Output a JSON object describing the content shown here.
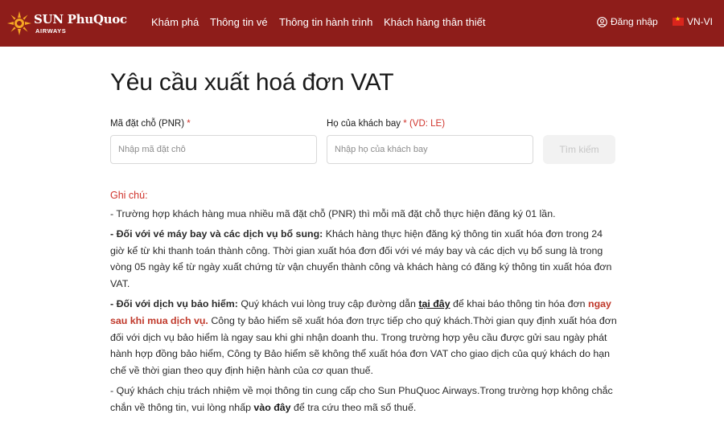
{
  "header": {
    "logo_main": "SUN PhuQuoc",
    "logo_sub": "AIRWAYS",
    "nav": [
      "Khám phá",
      "Thông tin vé",
      "Thông tin hành trình",
      "Khách hàng thân thiết"
    ],
    "login_label": "Đăng nhập",
    "lang_label": "VN-VI",
    "bg_color": "#8e1d1a"
  },
  "page": {
    "title": "Yêu cầu xuất hoá đơn VAT"
  },
  "form": {
    "pnr_label": "Mã đặt chỗ (PNR)",
    "pnr_required": "*",
    "pnr_placeholder": "Nhập mã đặt chỗ",
    "surname_label": "Họ của khách bay",
    "surname_required": "*",
    "surname_hint": "(VD: LE)",
    "surname_placeholder": "Nhập họ của khách bay",
    "search_label": "Tìm kiếm"
  },
  "notes": {
    "title": "Ghi chú:",
    "n1": "- Trường hợp khách hàng mua nhiều mã đặt chỗ (PNR) thì mỗi mã đặt chỗ thực hiện đăng ký 01 lần.",
    "n2_bold": "- Đối với vé máy bay và các dịch vụ bổ sung:",
    "n2_text": " Khách hàng thực hiện đăng ký thông tin xuất hóa đơn trong 24 giờ kể từ khi thanh toán thành công. Thời gian xuất hóa đơn đối với vé máy bay và các dịch vụ bổ sung là trong vòng 05 ngày kể từ ngày xuất chứng từ vận chuyển thành công và khách hàng có đăng ký thông tin xuất hóa đơn VAT.",
    "n3_bold": "- Đối với dịch vụ bảo hiểm:",
    "n3_text1": " Quý khách vui lòng truy cập đường dẫn ",
    "n3_link": "tại đây",
    "n3_text2": " để khai báo thông tin hóa đơn ",
    "n3_red": "ngay sau khi mua dịch vụ.",
    "n3_text3": " Công ty bảo hiểm sẽ xuất hóa đơn trực tiếp cho quý khách.Thời gian quy định xuất hóa đơn đối với dịch vụ bảo hiểm là ngay sau khi ghi nhận doanh thu. Trong trường hợp yêu cầu được gửi sau ngày phát hành hợp đồng bảo hiểm, Công ty Bảo hiểm sẽ không thể xuất hóa đơn VAT cho giao dịch của quý khách do hạn chế về thời gian theo quy định hiện hành của cơ quan thuế.",
    "n4_text1": "- Quý khách chịu trách nhiệm về mọi thông tin cung cấp cho Sun PhuQuoc Airways.Trong trường hợp không chắc chắn về thông tin, vui lòng nhấp ",
    "n4_link": "vào đây",
    "n4_text2": " để tra cứu theo mã số thuế."
  }
}
